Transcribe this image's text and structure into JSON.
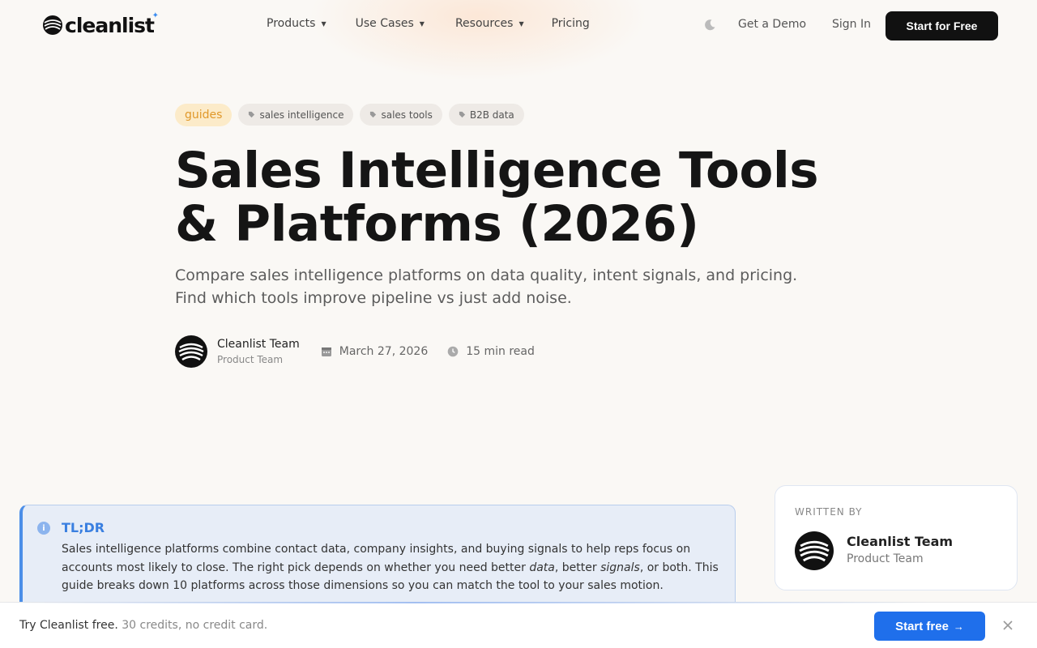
{
  "nav": {
    "logo_text": "cleanlist",
    "links": [
      {
        "label": "Products",
        "dropdown": true
      },
      {
        "label": "Use Cases",
        "dropdown": true
      },
      {
        "label": "Resources",
        "dropdown": true
      },
      {
        "label": "Pricing",
        "dropdown": false
      }
    ],
    "demo_label": "Get a Demo",
    "signin_label": "Sign In",
    "cta_label": "Start for Free"
  },
  "article": {
    "tags": [
      {
        "label": "guides",
        "primary": true
      },
      {
        "label": "sales intelligence",
        "primary": false
      },
      {
        "label": "sales tools",
        "primary": false
      },
      {
        "label": "B2B data",
        "primary": false
      }
    ],
    "title_line1": "Sales Intelligence Tools",
    "title_line2": "& Platforms (2026)",
    "subtitle_line1": "Compare sales intelligence platforms on data quality, intent signals, and pricing.",
    "subtitle_line2": "Find which tools improve pipeline vs just add noise.",
    "author_name": "Cleanlist Team",
    "author_role": "Product Team",
    "date": "March 27, 2026",
    "read_time": "15 min read"
  },
  "tldr": {
    "title": "TL;DR",
    "text_part1": "Sales intelligence platforms combine contact data, company insights, and buying signals to help reps focus on accounts most likely to close. The right pick depends on whether you need better ",
    "text_em1": "data",
    "text_part2": ", better ",
    "text_em2": "signals",
    "text_part3": ", or both. This guide breaks down 10 platforms across those dimensions so you can match the tool to your sales motion."
  },
  "written_by": {
    "label": "WRITTEN BY",
    "name": "Cleanlist Team",
    "role": "Product Team"
  },
  "bottom_bar": {
    "text_strong": "Try Cleanlist free.",
    "text_muted": "30 credits, no credit card.",
    "cta_label": "Start free",
    "cta_arrow": "→"
  },
  "colors": {
    "accent_blue": "#1f6feb",
    "tag_primary_bg": "#fcebc9",
    "tag_primary_text": "#e0982a",
    "tldr_accent": "#4b8ee8"
  },
  "icons": {
    "logo": "cleanlist-logo-icon",
    "theme": "moon-icon",
    "date": "calendar-icon",
    "read": "clock-icon",
    "info": "info-icon",
    "close": "close-icon"
  }
}
